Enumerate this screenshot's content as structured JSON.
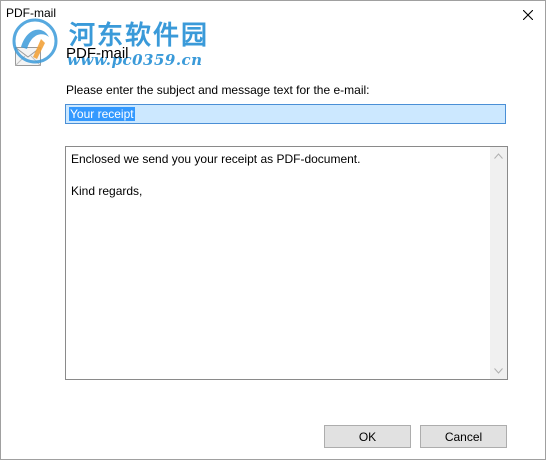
{
  "window": {
    "title": "PDF-mail"
  },
  "watermark": {
    "brand": "河东软件园",
    "url": "www.pc0359.cn"
  },
  "header": {
    "title": "PDF-mail",
    "icon": "envelope-pdf-icon"
  },
  "form": {
    "prompt": "Please enter the subject and message text for the e-mail:",
    "subject_value": "Your receipt",
    "message_value": "Enclosed we send you your receipt as PDF-document.\n\nKind regards,"
  },
  "buttons": {
    "ok_label": "OK",
    "cancel_label": "Cancel"
  },
  "colors": {
    "selection": "#3399ff",
    "subject_background": "#cce8ff",
    "watermark": "#3a9ad9"
  }
}
